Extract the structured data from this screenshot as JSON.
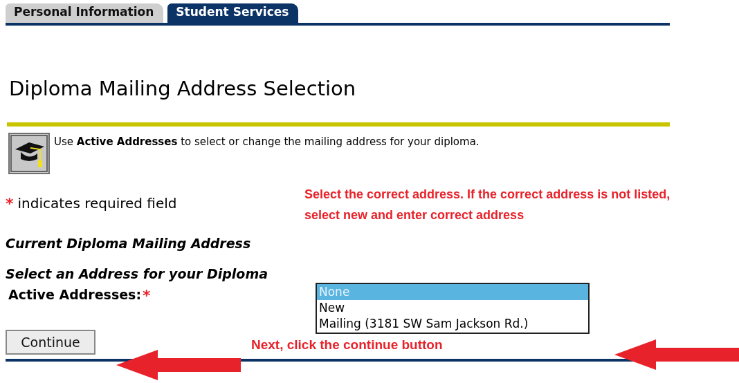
{
  "tabs": [
    {
      "label": "Personal Information",
      "selected": false
    },
    {
      "label": "Student Services",
      "selected": true
    }
  ],
  "title": "Diploma Mailing Address Selection",
  "info": "Use **Active Addresses** to select or change the mailing address for your diploma.",
  "required_note": {
    "marker": "*",
    "text": "indicates required field"
  },
  "callouts": [
    "Select the correct address. If the correct address is not listed, select new and enter correct address",
    "Next, click the continue button"
  ],
  "headings": [
    "Current Diploma Mailing Address",
    "Select an Address for your Diploma"
  ],
  "field": {
    "label": "Active Addresses:",
    "marker": "*",
    "options": [
      {
        "label": "None",
        "selected": true
      },
      {
        "label": "New",
        "selected": false
      },
      {
        "label": "Mailing (3181 SW Sam Jackson Rd.)",
        "selected": false
      }
    ]
  },
  "button": "Continue"
}
